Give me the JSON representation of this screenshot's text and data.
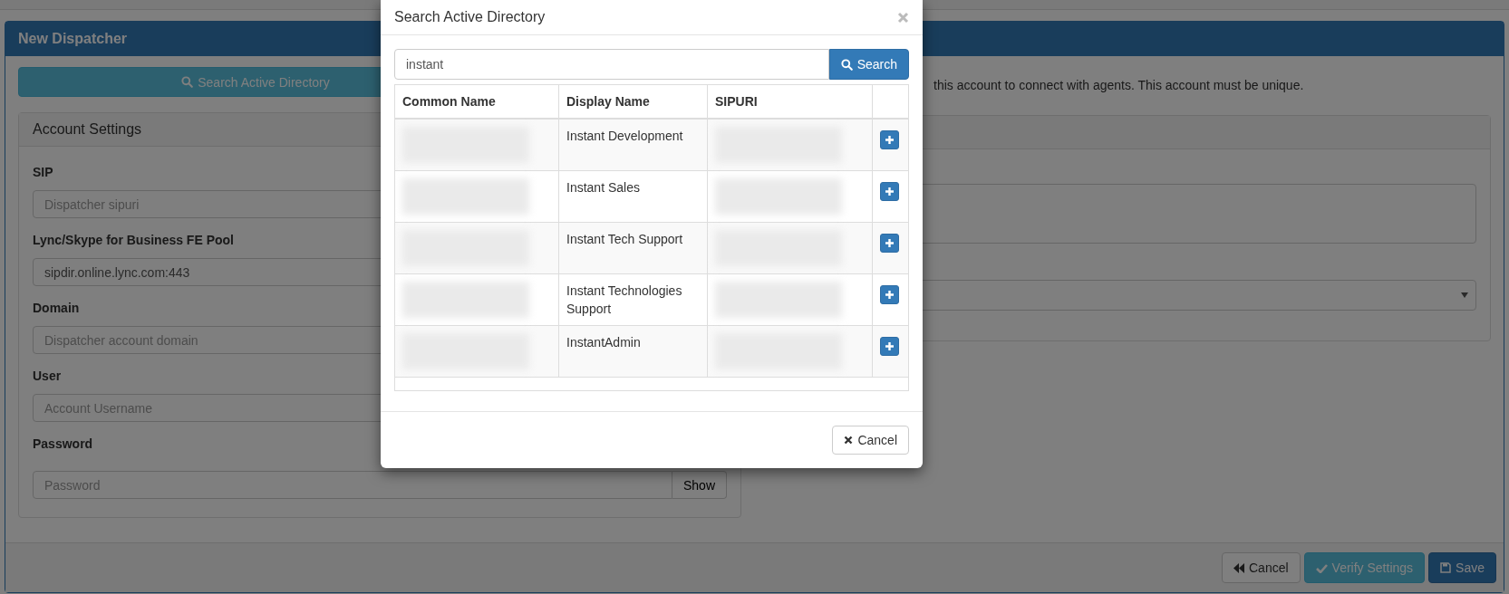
{
  "page_header": {
    "title": "New Dispatcher"
  },
  "left": {
    "search_button": "Search Active Directory",
    "account_settings": {
      "title": "Account Settings",
      "fields": [
        {
          "label": "SIP",
          "placeholder": "Dispatcher sipuri"
        },
        {
          "label": "Lync/Skype for Business FE Pool",
          "value": "sipdir.online.lync.com:443"
        },
        {
          "label": "Domain",
          "placeholder": "Dispatcher account domain"
        },
        {
          "label": "User",
          "placeholder": "Account Username"
        },
        {
          "label": "Password",
          "placeholder": "Password",
          "toggle": "Show"
        }
      ]
    }
  },
  "right": {
    "note": "this account to connect with agents. This account must be unique."
  },
  "footer_buttons": [
    {
      "label": "Cancel",
      "kind": "back"
    },
    {
      "label": "Verify Settings",
      "kind": "verify"
    },
    {
      "label": "Save",
      "kind": "save"
    }
  ],
  "modal": {
    "title": "Search Active Directory",
    "search": {
      "value": "instant",
      "button": "Search"
    },
    "table": {
      "columns": [
        "Common Name",
        "Display Name",
        "SIPURI"
      ],
      "rows": [
        {
          "display_name": "Instant Development"
        },
        {
          "display_name": "Instant Sales"
        },
        {
          "display_name": "Instant Tech Support"
        },
        {
          "display_name": "Instant Technologies Support"
        },
        {
          "display_name": "InstantAdmin"
        }
      ]
    },
    "cancel": "Cancel"
  }
}
